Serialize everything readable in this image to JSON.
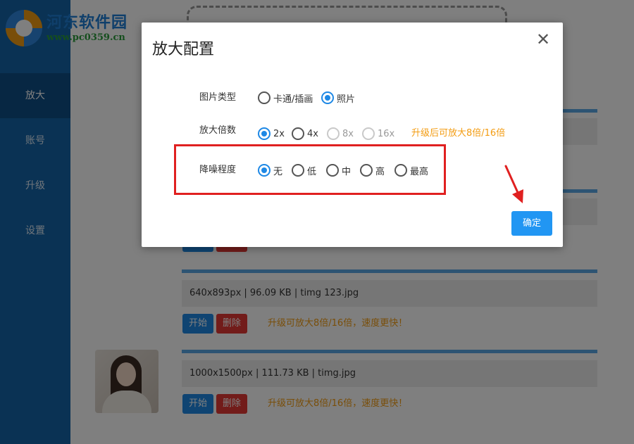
{
  "logo": {
    "title": "河东软件园",
    "url": "www.pc0359.cn"
  },
  "sidebar": {
    "items": [
      {
        "label": "放大",
        "active": true
      },
      {
        "label": "账号",
        "active": false
      },
      {
        "label": "升级",
        "active": false
      },
      {
        "label": "设置",
        "active": false
      }
    ]
  },
  "files": [
    {
      "info": "640x893px | 96.09 KB | timg 123.jpg",
      "start": "开始",
      "delete": "删除",
      "tip": "升级可放大8倍/16倍，速度更快！"
    },
    {
      "info": "1000x1500px | 111.73 KB | timg.jpg",
      "start": "开始",
      "delete": "删除",
      "tip": "升级可放大8倍/16倍，速度更快！"
    }
  ],
  "dialog": {
    "title": "放大配置",
    "close_icon": "close-icon",
    "image_type": {
      "label": "图片类型",
      "options": [
        {
          "label": "卡通/插画",
          "checked": false
        },
        {
          "label": "照片",
          "checked": true
        }
      ]
    },
    "scale": {
      "label": "放大倍数",
      "options": [
        {
          "label": "2x",
          "checked": true,
          "disabled": false
        },
        {
          "label": "4x",
          "checked": false,
          "disabled": false
        },
        {
          "label": "8x",
          "checked": false,
          "disabled": true
        },
        {
          "label": "16x",
          "checked": false,
          "disabled": true
        }
      ],
      "hint": "升级后可放大8倍/16倍"
    },
    "denoise": {
      "label": "降噪程度",
      "options": [
        {
          "label": "无",
          "checked": true
        },
        {
          "label": "低",
          "checked": false
        },
        {
          "label": "中",
          "checked": false
        },
        {
          "label": "高",
          "checked": false
        },
        {
          "label": "最高",
          "checked": false
        }
      ]
    },
    "confirm": "确定"
  },
  "colors": {
    "accent": "#1e88e5",
    "sidebar": "#1565a8",
    "warning": "#f39c12",
    "danger": "#e53935",
    "annotation": "#e02020"
  }
}
